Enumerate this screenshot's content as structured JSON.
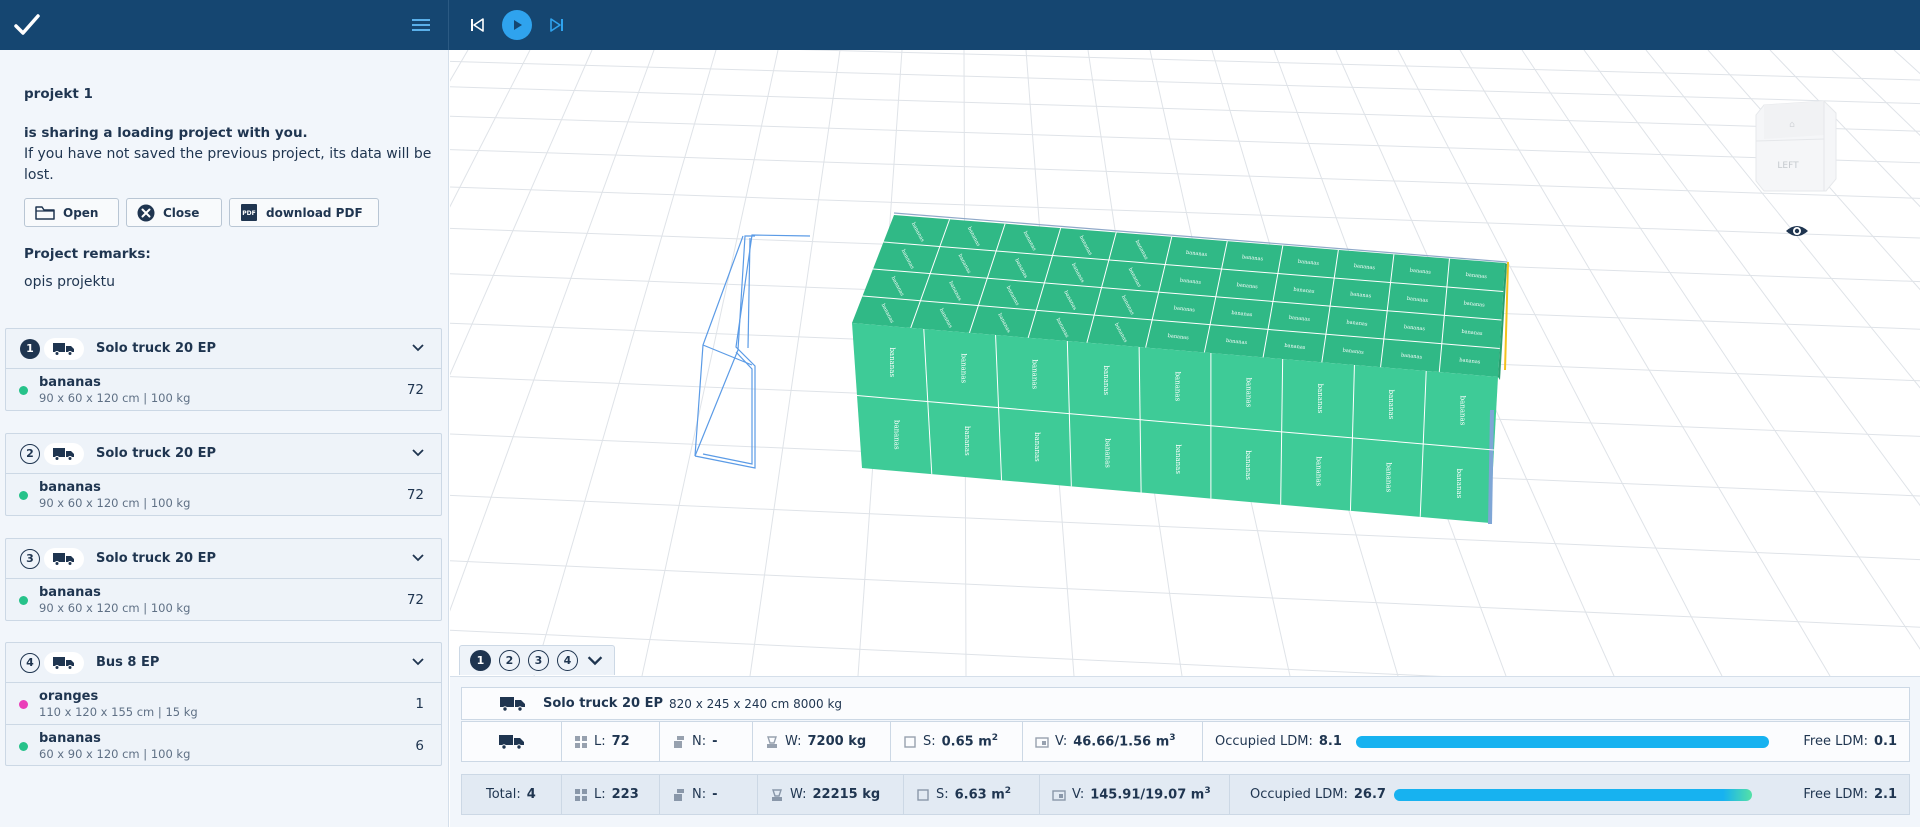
{
  "topbar": {
    "logo_icon": "checkmark-logo-icon",
    "menu_icon": "hamburger-menu-icon",
    "player": [
      "skip-back-icon",
      "play-icon",
      "skip-forward-icon"
    ]
  },
  "share": {
    "project_name": "projekt 1",
    "message": "is sharing a loading project with you.",
    "warning": "If you have not saved the previous project, its data will be lost.",
    "buttons": {
      "open": "Open",
      "close": "Close",
      "download": "download PDF"
    },
    "remarks_label": "Project remarks:",
    "remarks_text": "opis projektu"
  },
  "vehicles": [
    {
      "number": "1",
      "name": "Solo truck 20 EP",
      "items": [
        {
          "name": "bananas",
          "dims": "90 x 60 x 120 cm | 100 kg",
          "qty": "72",
          "color": "#26c28a"
        }
      ]
    },
    {
      "number": "2",
      "name": "Solo truck 20 EP",
      "items": [
        {
          "name": "bananas",
          "dims": "90 x 60 x 120 cm | 100 kg",
          "qty": "72",
          "color": "#26c28a"
        }
      ]
    },
    {
      "number": "3",
      "name": "Solo truck 20 EP",
      "items": [
        {
          "name": "bananas",
          "dims": "90 x 60 x 120 cm | 100 kg",
          "qty": "72",
          "color": "#26c28a"
        }
      ]
    },
    {
      "number": "4",
      "name": "Bus 8 EP",
      "items": [
        {
          "name": "oranges",
          "dims": "110 x 120 x 155 cm | 15 kg",
          "qty": "1",
          "color": "#ea3fb9"
        },
        {
          "name": "bananas",
          "dims": "60 x 90 x 120 cm | 100 kg",
          "qty": "6",
          "color": "#26c28a"
        }
      ]
    }
  ],
  "scene": {
    "cargo_label": "bananas",
    "cube_face": "LEFT",
    "cargo_color": "#3ecb97"
  },
  "tabs": [
    "1",
    "2",
    "3",
    "4"
  ],
  "selected": {
    "name": "Solo truck 20 EP",
    "spec": "820 x 245 x 240 cm 8000 kg",
    "stats": {
      "l_label": "L:",
      "l": "72",
      "n_label": "N:",
      "n": "-",
      "w_label": "W:",
      "w": "7200 kg",
      "s_label": "S:",
      "s": "0.65 m",
      "s_sup": "2",
      "v_label": "V:",
      "v": "46.66/1.56 m",
      "v_sup": "3",
      "occupied_label": "Occupied LDM:",
      "occupied": "8.1",
      "occupied_fraction": 0.99,
      "free_label": "Free LDM:",
      "free": "0.1"
    }
  },
  "totals": {
    "total_label": "Total:",
    "total": "4",
    "l_label": "L:",
    "l": "223",
    "n_label": "N:",
    "n": "-",
    "w_label": "W:",
    "w": "22215 kg",
    "s_label": "S:",
    "s": "6.63 m",
    "s_sup": "2",
    "v_label": "V:",
    "v": "145.91/19.07 m",
    "v_sup": "3",
    "occupied_label": "Occupied LDM:",
    "occupied": "26.7",
    "occupied_fraction": 0.93,
    "free_label": "Free LDM:",
    "free": "2.1"
  },
  "colors": {
    "topbar": "#154671",
    "accent": "#2fa3ee",
    "ldm_bar": "#17b2f0"
  }
}
